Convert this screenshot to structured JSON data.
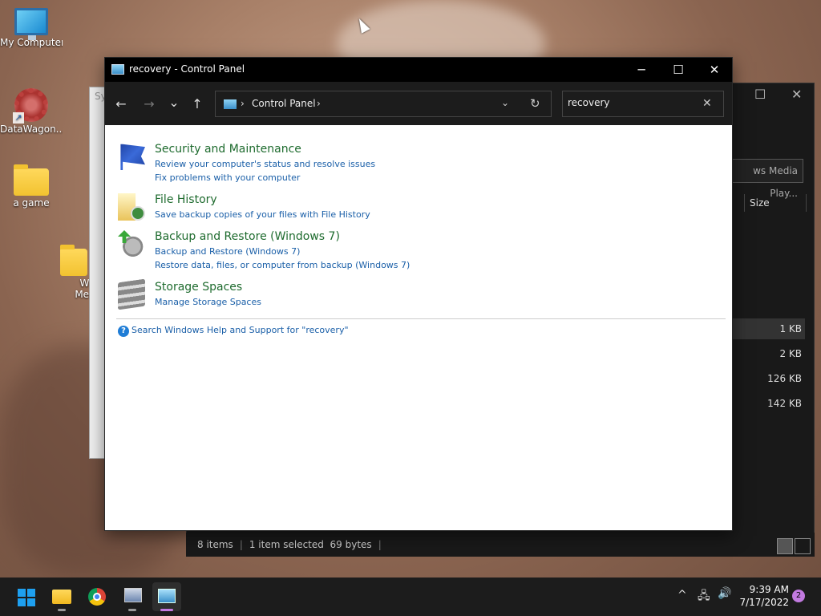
{
  "desktop": {
    "icons": [
      {
        "label": "My Computer",
        "icon": "monitor-icon"
      },
      {
        "label": "DataWagon...",
        "icon": "gear-shortcut-icon"
      },
      {
        "label": "a game",
        "icon": "folder-icon"
      },
      {
        "label": "Win\nMedi",
        "icon": "folder-icon"
      }
    ]
  },
  "background_window": {
    "tab_label": "ws Media Play...",
    "size_header": "Size",
    "sizes": [
      "1 KB",
      "2 KB",
      "126 KB",
      "142 KB"
    ],
    "status": {
      "items": "8 items",
      "selected": "1 item selected",
      "bytes": "69 bytes"
    },
    "left_fragment": "Sy"
  },
  "window": {
    "title": "recovery - Control Panel",
    "minimize": "─",
    "maximize": "☐",
    "close": "✕"
  },
  "nav": {
    "back": "←",
    "forward": "→",
    "recent": "⌄",
    "up": "↑",
    "breadcrumb": "Control Panel",
    "refresh": "↻",
    "dropdown": "⌄"
  },
  "search": {
    "value": "recovery",
    "clear": "✕"
  },
  "results": [
    {
      "title": "Security and Maintenance",
      "icon": "flag-icon",
      "links": [
        "Review your computer's status and resolve issues",
        "Fix problems with your computer"
      ]
    },
    {
      "title": "File History",
      "icon": "file-history-icon",
      "links": [
        "Save backup copies of your files with File History"
      ]
    },
    {
      "title": "Backup and Restore (Windows 7)",
      "icon": "backup-icon",
      "links": [
        "Backup and Restore (Windows 7)",
        "Restore data, files, or computer from backup (Windows 7)"
      ]
    },
    {
      "title": "Storage Spaces",
      "icon": "storage-icon",
      "links": [
        "Manage Storage Spaces"
      ]
    }
  ],
  "help_link": "Search Windows Help and Support for \"recovery\"",
  "taskbar": {
    "apps": [
      "start-icon",
      "file-explorer-icon",
      "chrome-icon",
      "system-icon",
      "control-panel-icon"
    ],
    "tray": {
      "chevron": "^",
      "network": "🖧",
      "volume": "🔊"
    },
    "time": "9:39 AM",
    "date": "7/17/2022",
    "notifications": "2"
  }
}
